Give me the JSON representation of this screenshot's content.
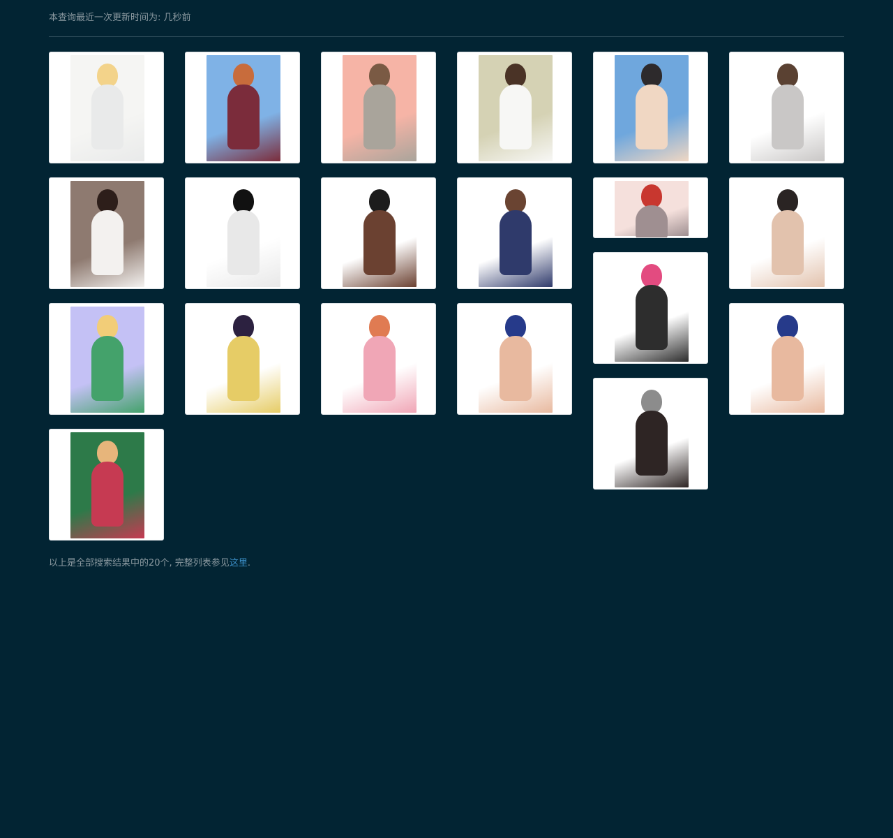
{
  "header": {
    "updated_text": "本查询最近一次更新时间为: 几秒前"
  },
  "gallery": {
    "images": [
      {
        "name": "image-card-1",
        "palette": [
          "#f5f5f3",
          "#f3d38a",
          "#e9eaea"
        ]
      },
      {
        "name": "image-card-2",
        "palette": [
          "#7fb2e6",
          "#c86c3c",
          "#7b2c3b"
        ]
      },
      {
        "name": "image-card-3",
        "palette": [
          "#f6b4a6",
          "#7a5a44",
          "#a9a49b"
        ]
      },
      {
        "name": "image-card-4",
        "palette": [
          "#d5d2b4",
          "#4a3326",
          "#f7f7f5"
        ]
      },
      {
        "name": "image-card-5",
        "palette": [
          "#6fa7dd",
          "#2d2a2c",
          "#f0d7c3"
        ]
      },
      {
        "name": "image-card-6",
        "palette": [
          "#ffffff",
          "#5a4132",
          "#c9c7c6"
        ]
      },
      {
        "name": "image-card-7",
        "palette": [
          "#8e7a70",
          "#2d1e1a",
          "#f3f1ef"
        ]
      },
      {
        "name": "image-card-8",
        "palette": [
          "#ffffff",
          "#111111",
          "#e8e8e8"
        ]
      },
      {
        "name": "image-card-9",
        "palette": [
          "#ffffff",
          "#1c1c1c",
          "#6b4131"
        ]
      },
      {
        "name": "image-card-10",
        "palette": [
          "#ffffff",
          "#6a4432",
          "#2f3a6b"
        ]
      },
      {
        "name": "image-card-11",
        "palette": [
          "#f5e0dc",
          "#c8372f",
          "#9f8f91"
        ]
      },
      {
        "name": "image-card-12",
        "palette": [
          "#ffffff",
          "#2a2423",
          "#e2c2ad"
        ]
      },
      {
        "name": "image-card-13",
        "palette": [
          "#c4c1f5",
          "#f2cd78",
          "#44a26b"
        ]
      },
      {
        "name": "image-card-14",
        "palette": [
          "#ffffff",
          "#2c2140",
          "#e6cc66"
        ]
      },
      {
        "name": "image-card-15",
        "palette": [
          "#ffffff",
          "#e07b52",
          "#f0a6b6"
        ]
      },
      {
        "name": "image-card-16",
        "palette": [
          "#ffffff",
          "#263a8a",
          "#e8b99f"
        ]
      },
      {
        "name": "image-card-17",
        "palette": [
          "#ffffff",
          "#e34b80",
          "#2d2d2d"
        ]
      },
      {
        "name": "image-card-18",
        "palette": [
          "#ffffff",
          "#263a8a",
          "#e8b99f"
        ]
      },
      {
        "name": "image-card-19",
        "palette": [
          "#ffffff",
          "#8c8c8c",
          "#2e2524"
        ]
      },
      {
        "name": "image-card-20",
        "palette": [
          "#2d7a49",
          "#e7b57b",
          "#c63a52"
        ]
      }
    ]
  },
  "footer": {
    "prefix": "以上是全部搜索结果中的20个, 完整列表参见",
    "link_label": "这里",
    "suffix": "."
  }
}
